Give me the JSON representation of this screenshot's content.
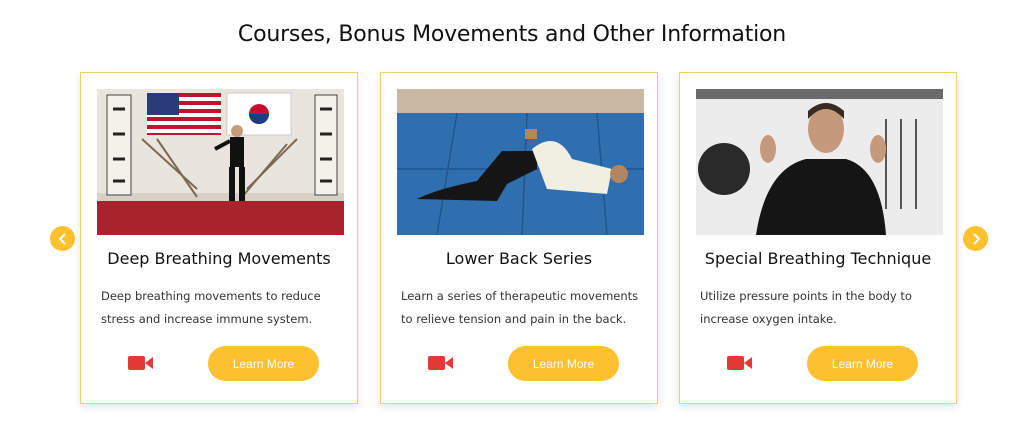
{
  "page": {
    "heading": "Courses, Bonus Movements and Other Information"
  },
  "carousel": {
    "prev_icon": "chevron-left-icon",
    "next_icon": "chevron-right-icon",
    "accent": "#fdc02f"
  },
  "cards": [
    {
      "title": "Deep Breathing Movements",
      "description": "Deep breathing movements to reduce stress and increase immune system.",
      "button_label": "Learn More",
      "icon": "video-camera-icon"
    },
    {
      "title": "Lower Back Series",
      "description": "Learn a series of therapeutic movements to relieve tension and pain in the back.",
      "button_label": "Learn More",
      "icon": "video-camera-icon"
    },
    {
      "title": "Special Breathing Technique",
      "description": "Utilize pressure points in the body to increase oxygen intake.",
      "button_label": "Learn More",
      "icon": "video-camera-icon"
    }
  ],
  "colors": {
    "button": "#fdc02f",
    "video_icon": "#e53935",
    "card_border": "#f3cf6a"
  }
}
